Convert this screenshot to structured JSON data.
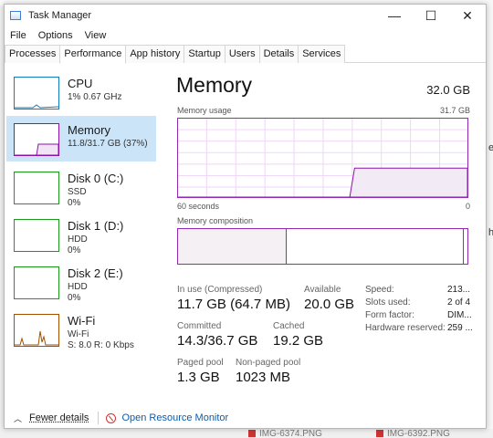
{
  "window": {
    "title": "Task Manager",
    "controls": {
      "minimize": "—",
      "maximize": "☐",
      "close": "✕"
    }
  },
  "menu": [
    "File",
    "Options",
    "View"
  ],
  "tabs": [
    "Processes",
    "Performance",
    "App history",
    "Startup",
    "Users",
    "Details",
    "Services"
  ],
  "active_tab": "Performance",
  "sidebar": {
    "items": [
      {
        "name": "CPU",
        "line1": "1% 0.67 GHz",
        "line2": "",
        "line3": ""
      },
      {
        "name": "Memory",
        "line1": "11.8/31.7 GB (37%)",
        "line2": "",
        "line3": ""
      },
      {
        "name": "Disk 0 (C:)",
        "line1": "SSD",
        "line2": "0%",
        "line3": ""
      },
      {
        "name": "Disk 1 (D:)",
        "line1": "HDD",
        "line2": "0%",
        "line3": ""
      },
      {
        "name": "Disk 2 (E:)",
        "line1": "HDD",
        "line2": "0%",
        "line3": ""
      },
      {
        "name": "Wi-Fi",
        "line1": "Wi-Fi",
        "line2": "S: 8.0 R: 0 Kbps",
        "line3": ""
      }
    ],
    "selected": "Memory"
  },
  "detail": {
    "title": "Memory",
    "total": "32.0 GB",
    "usage_label": "Memory usage",
    "usage_max": "31.7 GB",
    "time_left": "60 seconds",
    "time_right": "0",
    "composition_label": "Memory composition",
    "usage_history_fraction": [
      0.0,
      0.0,
      0.0,
      0.0,
      0.0,
      0.0,
      0.0,
      0.0,
      0.0,
      0.0,
      0.0,
      0.0,
      0.0,
      0.0,
      0.0,
      0.0,
      0.0,
      0.0,
      0.0,
      0.0,
      0.0,
      0.0,
      0.0,
      0.0,
      0.0,
      0.0,
      0.0,
      0.0,
      0.0,
      0.0,
      0.0,
      0.0,
      0.0,
      0.0,
      0.0,
      0.0,
      0.37,
      0.37,
      0.37,
      0.37,
      0.37,
      0.37,
      0.37,
      0.37,
      0.37,
      0.37,
      0.37,
      0.37,
      0.37,
      0.37,
      0.37,
      0.37,
      0.37,
      0.37,
      0.37,
      0.37,
      0.37,
      0.37,
      0.37,
      0.37
    ],
    "in_use_fraction": 0.37,
    "stats": {
      "in_use_label": "In use (Compressed)",
      "in_use_value": "11.7 GB (64.7 MB)",
      "available_label": "Available",
      "available_value": "20.0 GB",
      "committed_label": "Committed",
      "committed_value": "14.3/36.7 GB",
      "cached_label": "Cached",
      "cached_value": "19.2 GB",
      "paged_label": "Paged pool",
      "paged_value": "1.3 GB",
      "nonpaged_label": "Non-paged pool",
      "nonpaged_value": "1023 MB"
    },
    "properties": [
      {
        "key": "Speed:",
        "value": "213..."
      },
      {
        "key": "Slots used:",
        "value": "2 of 4"
      },
      {
        "key": "Form factor:",
        "value": "DIM..."
      },
      {
        "key": "Hardware reserved:",
        "value": "259 ..."
      }
    ]
  },
  "footer": {
    "fewer": "Fewer details",
    "resmon": "Open Resource Monitor"
  },
  "background": {
    "right_peek": [
      "ev",
      "h"
    ],
    "bottom_files": [
      "IMG-6374.PNG",
      "IMG-6392.PNG"
    ]
  },
  "colors": {
    "memory": "#8b12ae",
    "disk": "#1a9c1a",
    "cpu": "#117dbb",
    "wifi": "#a74f01",
    "selection": "#cce4f7",
    "link": "#0b5cad"
  }
}
